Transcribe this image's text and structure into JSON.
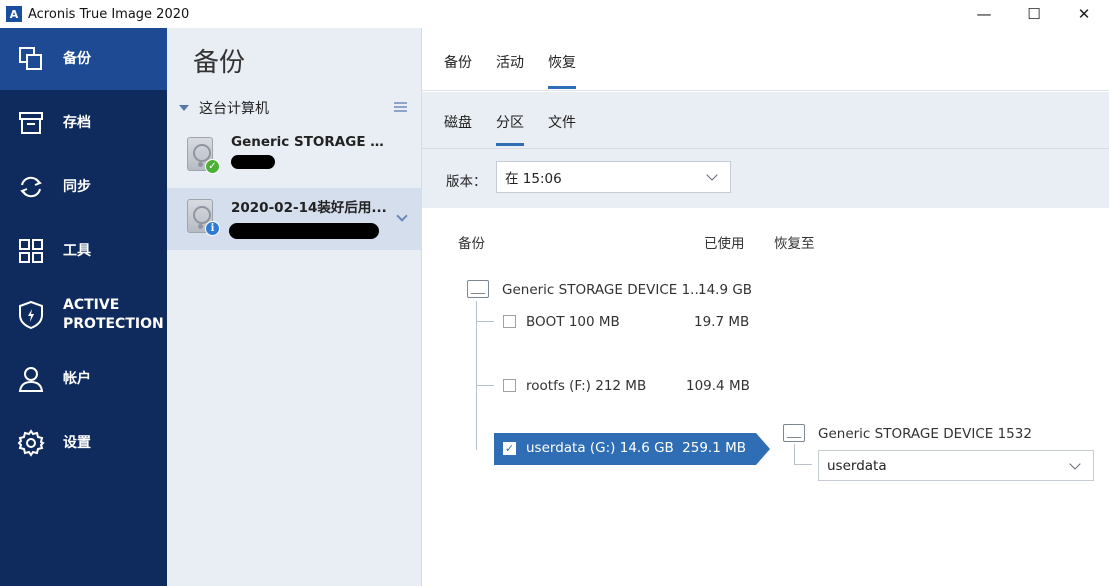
{
  "window": {
    "logo_letter": "A",
    "title": "Acronis True Image 2020",
    "minimize": "—",
    "maximize": "☐",
    "close": "✕"
  },
  "nav": {
    "items": [
      {
        "label": "备份",
        "icon": "backup-icon",
        "active": true
      },
      {
        "label": "存档",
        "icon": "archive-icon"
      },
      {
        "label": "同步",
        "icon": "sync-icon"
      },
      {
        "label": "工具",
        "icon": "tools-icon"
      },
      {
        "label": "ACTIVE\nPROTECTION",
        "label_line1": "ACTIVE",
        "label_line2": "PROTECTION",
        "icon": "shield-icon"
      },
      {
        "label": "帐户",
        "icon": "account-icon"
      },
      {
        "label": "设置",
        "icon": "gear-icon"
      }
    ]
  },
  "backups": {
    "title": "备份",
    "group_label": "这台计算机",
    "items": [
      {
        "name": "Generic STORAGE DE...",
        "status": "ok",
        "badge": "✓"
      },
      {
        "name": "2020-02-14装好后用...",
        "status": "info",
        "badge": "i",
        "selected": true
      }
    ]
  },
  "tabs": {
    "top": [
      "备份",
      "活动",
      "恢复"
    ],
    "active_top": "恢复",
    "sub": [
      "磁盘",
      "分区",
      "文件"
    ],
    "active_sub": "分区"
  },
  "version": {
    "label": "版本：",
    "value": "在 15:06"
  },
  "columns": {
    "backup": "备份",
    "used": "已使用",
    "restore_to": "恢复至"
  },
  "partitions": {
    "disk_name": "Generic STORAGE DEVICE 1...",
    "disk_size": "14.9 GB",
    "rows": [
      {
        "label": "BOOT 100 MB",
        "used": "19.7 MB",
        "checked": false
      },
      {
        "label": "rootfs (F:) 212 MB",
        "used": "109.4 MB",
        "checked": false
      },
      {
        "label": "userdata (G:) 14.6 GB",
        "used": "259.1 MB",
        "checked": true,
        "check_mark": "✓"
      }
    ]
  },
  "destination": {
    "disk_name": "Generic STORAGE DEVICE 1532",
    "partition": "userdata"
  }
}
